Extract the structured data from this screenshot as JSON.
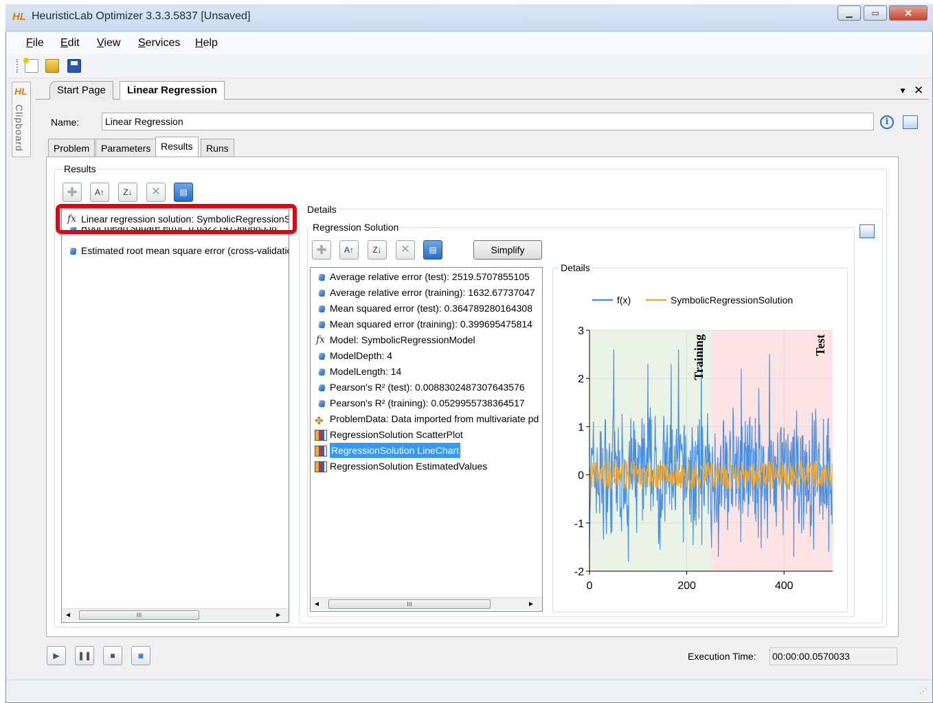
{
  "window": {
    "logo": "HL",
    "title": "HeuristicLab Optimizer 3.3.3.5837 [Unsaved]",
    "min_glyph": "▁",
    "max_glyph": "▭",
    "close_glyph": "✕"
  },
  "menu": {
    "file": "ile",
    "file_u": "F",
    "edit": "dit",
    "edit_u": "E",
    "view": "iew",
    "view_u": "V",
    "services": "ervices",
    "services_u": "S",
    "help": "elp",
    "help_u": "H"
  },
  "sidebar": {
    "logo": "HL",
    "clipboard": "Clipboard"
  },
  "doc_tabs": {
    "start_page": "Start Page",
    "linear_regression": "Linear Regression",
    "dropdown_glyph": "▼",
    "close_glyph": "✕"
  },
  "name_field": {
    "label": "Name:",
    "value": "Linear Regression"
  },
  "sub_tabs": {
    "problem": "Problem",
    "parameters": "Parameters",
    "results": "Results",
    "runs": "Runs"
  },
  "results": {
    "title": "Results",
    "items": [
      "Linear regression solution: SymbolicRegressionSolution",
      "Root mean square error: 0.632214758088558",
      "Estimated root mean square error (cross-validation)"
    ]
  },
  "details_outer": {
    "title": "Details"
  },
  "regression_solution": {
    "title": "Regression Solution",
    "simplify": "Simplify",
    "items": [
      "Average relative error (test): 2519.5707855105",
      "Average relative error (training): 1632.67737047",
      "Mean squared error (test): 0.364789280164308",
      "Mean squared error (training): 0.399695475814",
      "Model: SymbolicRegressionModel",
      "ModelDepth: 4",
      "ModelLength: 14",
      "Pearson's R² (test): 0.0088302487307643576",
      "Pearson's R² (training): 0.0529955738364517",
      "ProblemData: Data imported from multivariate pd",
      "RegressionSolution ScatterPlot",
      "RegressionSolution LineChart",
      "RegressionSolution EstimatedValues"
    ]
  },
  "details_inner": {
    "title": "Details"
  },
  "chart_data": {
    "type": "line",
    "series": [
      {
        "name": "f(x)",
        "color": "#4a8fe0"
      },
      {
        "name": "SymbolicRegressionSolution",
        "color": "#f0a830"
      }
    ],
    "x_ticks": [
      "0",
      "200",
      "400"
    ],
    "y_ticks": [
      "3",
      "2",
      "1",
      "0",
      "-1",
      "-2"
    ],
    "xlim": [
      0,
      500
    ],
    "ylim": [
      -2,
      3
    ],
    "regions": [
      {
        "label": "Training",
        "x_start": 0,
        "x_end": 250,
        "color": "#eaf3e6"
      },
      {
        "label": "Test",
        "x_start": 250,
        "x_end": 500,
        "color": "#fde3e3"
      }
    ],
    "n_points": 500,
    "fx_amplitude": 1.6,
    "fx_spikes": [
      {
        "x": 50,
        "y": 2.6
      },
      {
        "x": 120,
        "y": 2.3
      },
      {
        "x": 168,
        "y": 2.3
      },
      {
        "x": 183,
        "y": 2.6
      },
      {
        "x": 230,
        "y": 2.7
      },
      {
        "x": 370,
        "y": 2.5
      },
      {
        "x": 312,
        "y": 2.2
      },
      {
        "x": 348,
        "y": 1.8
      },
      {
        "x": 80,
        "y": -1.8
      },
      {
        "x": 265,
        "y": -1.7
      },
      {
        "x": 420,
        "y": -1.7
      },
      {
        "x": 492,
        "y": -1.6
      }
    ],
    "solution_amplitude": 0.3
  },
  "controls": {
    "play": "▶",
    "pause": "❚❚",
    "stop": "■",
    "reset": "◙"
  },
  "execution": {
    "label": "Execution Time:",
    "value": "00:00:00.0570033"
  },
  "scroll": {
    "thumb": "III",
    "left": "◂",
    "right": "▸"
  },
  "toolbar_icons": [
    "new-icon",
    "open-icon",
    "save-icon"
  ]
}
